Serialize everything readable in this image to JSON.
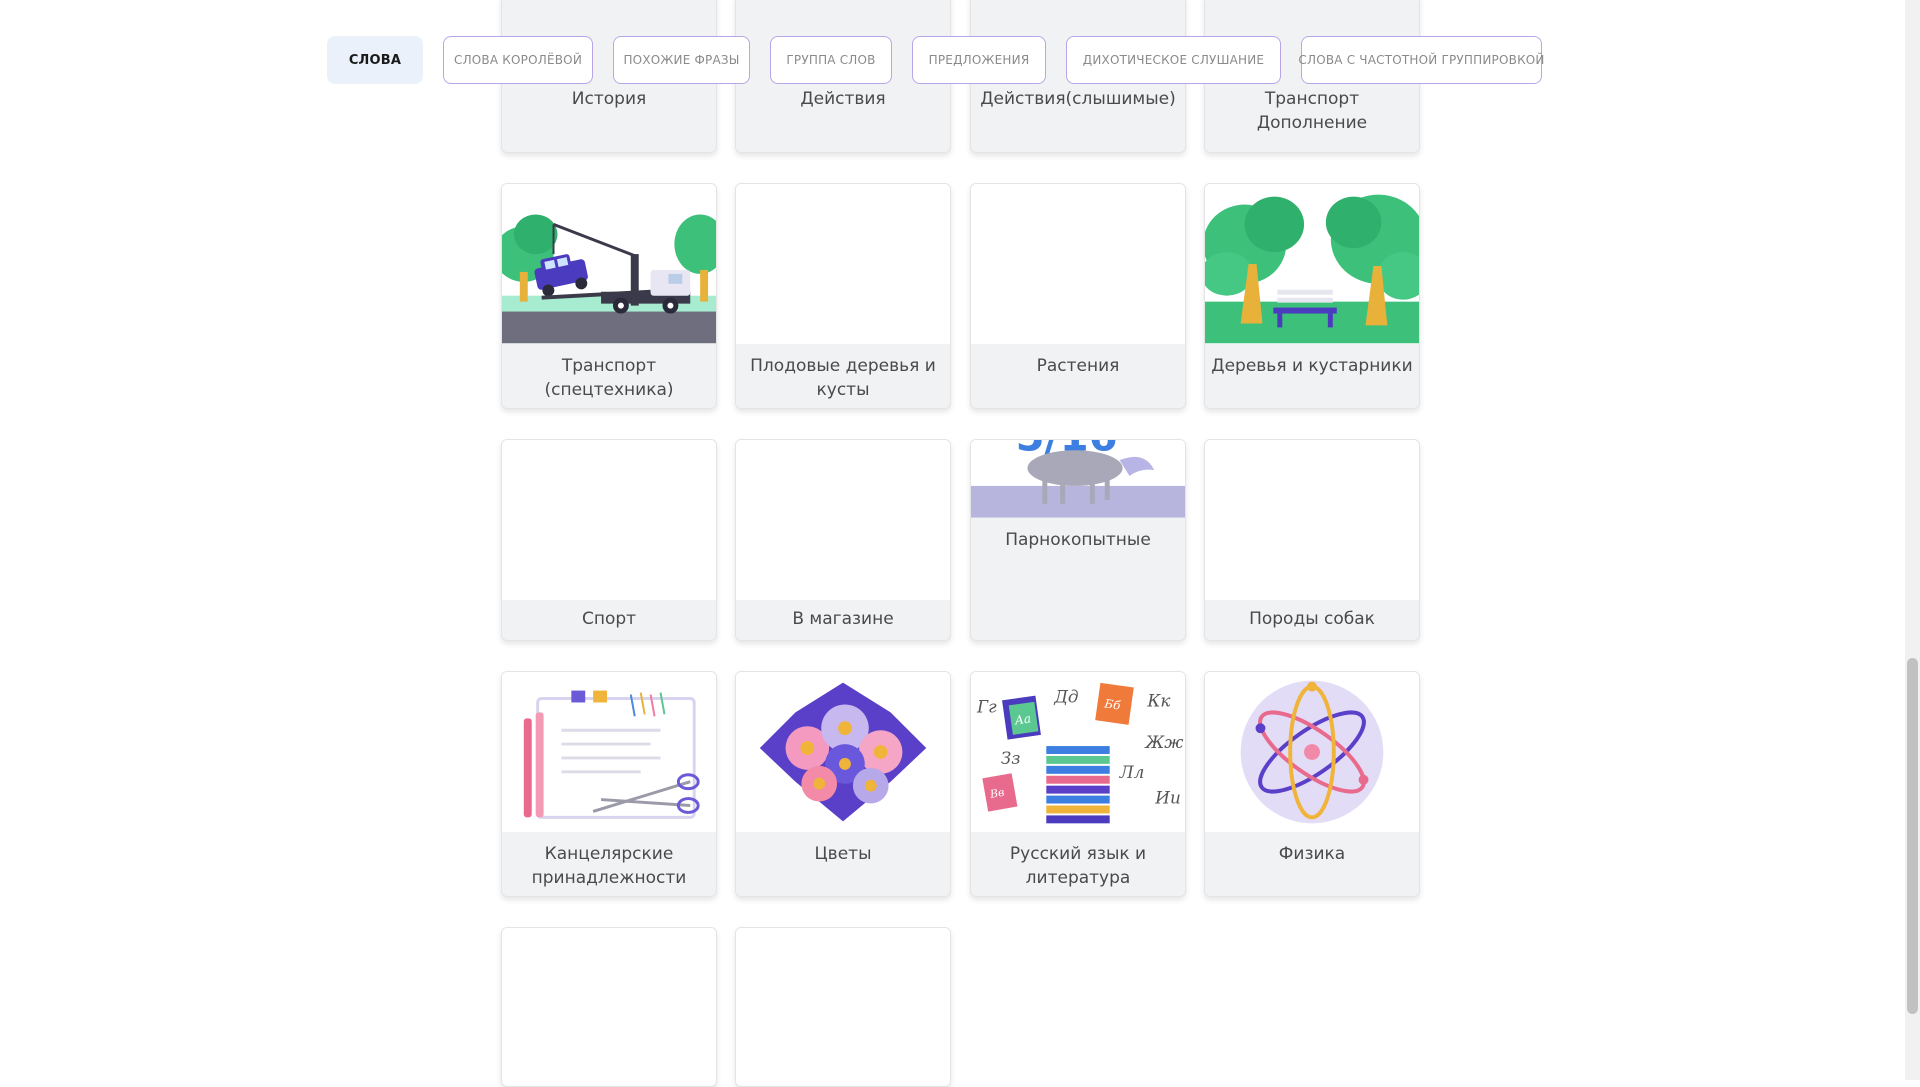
{
  "tabs": [
    {
      "label": "СЛОВА",
      "active": true
    },
    {
      "label": "СЛОВА КОРОЛЁВОЙ"
    },
    {
      "label": "ПОХОЖИЕ ФРАЗЫ"
    },
    {
      "label": "ГРУППА СЛОВ"
    },
    {
      "label": "ПРЕДЛОЖЕНИЯ"
    },
    {
      "label": "ДИХОТИЧЕСКОЕ СЛУШАНИЕ"
    },
    {
      "label": "СЛОВА С ЧАСТОТНОЙ ГРУППИРОВКОЙ"
    }
  ],
  "cards": {
    "history": "История",
    "actions": "Действия",
    "actions_heard": "Действия(слышимые)",
    "transport_extra": "Транспорт Дополнение",
    "transport_special": "Транспорт (спецтехника)",
    "fruit_trees": "Плодовые деревья и кусты",
    "plants": "Растения",
    "trees_shrubs": "Деревья и кустарники",
    "sport": "Спорт",
    "in_shop": "В магазине",
    "artiodactyls": "Парнокопытные",
    "dog_breeds": "Породы собак",
    "stationery": "Канцелярские принадлежности",
    "flowers": "Цветы",
    "russian_lit": "Русский язык и литература",
    "physics": "Физика"
  },
  "letters": [
    "Гг",
    "Аа",
    "Дд",
    "Бб",
    "Кк",
    "Зз",
    "Жж",
    "Лл",
    "Вв",
    "Ии"
  ],
  "colors": {
    "tab_border": "#b9a6e8",
    "active_tab_bg": "#eaf1fb",
    "card_bg": "#f1f2f4",
    "tree_green": "#3cc07a",
    "purple": "#4b3bbf"
  },
  "icons": [
    "tow-truck-icon",
    "park-bench-icon",
    "horse-icon",
    "stationery-icon",
    "flowers-icon",
    "books-icon",
    "atom-icon"
  ]
}
